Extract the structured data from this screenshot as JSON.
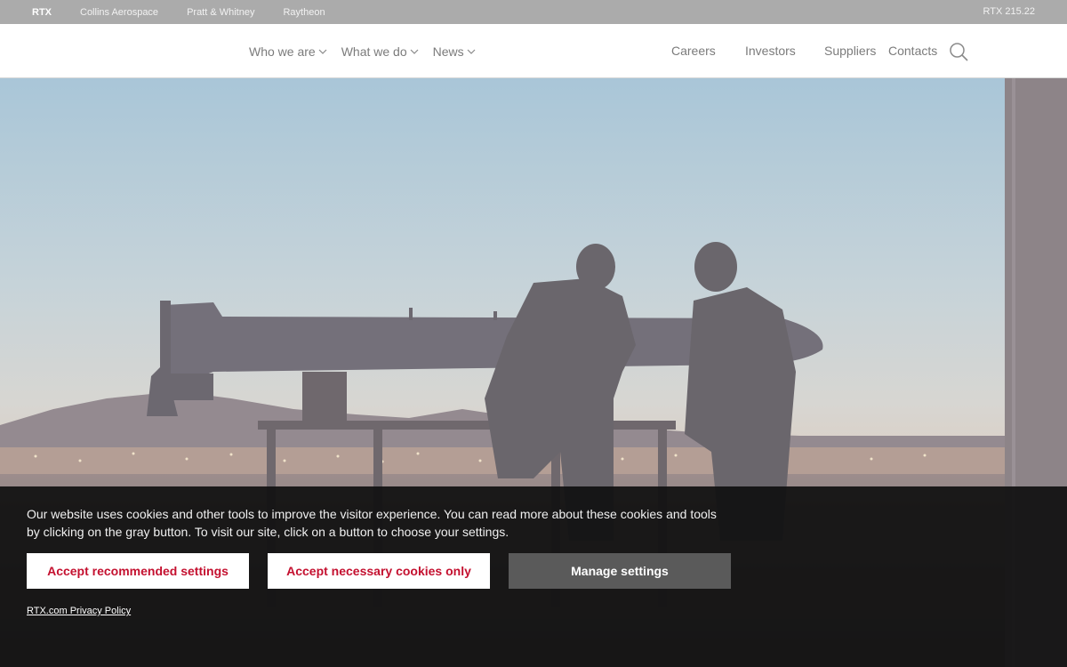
{
  "brand_strip": {
    "brands": [
      "RTX",
      "Collins Aerospace",
      "Pratt & Whitney",
      "Raytheon"
    ],
    "ticker": "RTX 215.22"
  },
  "nav": {
    "primary": [
      "Who we are",
      "What we do",
      "News"
    ],
    "secondary": [
      "Careers",
      "Investors",
      "Suppliers",
      "Contacts"
    ]
  },
  "cookie": {
    "message": "Our website uses cookies and other tools to improve the visitor experience. You can read more about these cookies and tools by clicking on the gray button. To visit our site, click on a button to choose your settings.",
    "accept_recommended": "Accept recommended settings",
    "accept_necessary": "Accept necessary cookies only",
    "manage": "Manage settings",
    "privacy_link": "RTX.com Privacy Policy"
  },
  "colors": {
    "accent_red": "#c4102f",
    "manage_gray": "#5a5a5a",
    "brand_strip_gray": "#ababab"
  }
}
